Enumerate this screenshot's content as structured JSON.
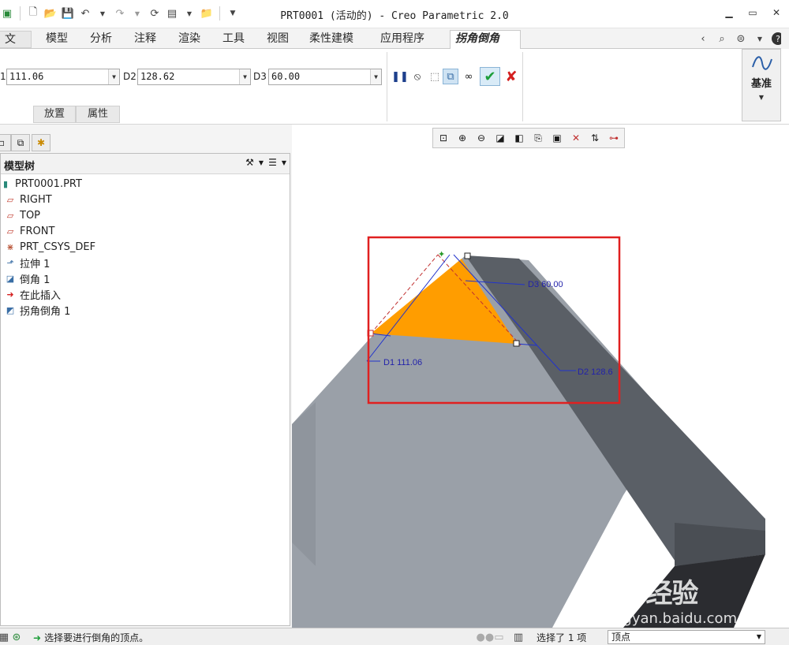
{
  "window": {
    "title": "PRT0001 (活动的) - Creo Parametric 2.0"
  },
  "tabs": [
    {
      "label": "文件",
      "left": 0
    },
    {
      "label": "模型"
    },
    {
      "label": "分析"
    },
    {
      "label": "注释"
    },
    {
      "label": "渲染"
    },
    {
      "label": "工具"
    },
    {
      "label": "视图"
    },
    {
      "label": "柔性建模"
    },
    {
      "label": "应用程序"
    },
    {
      "label": "拐角倒角"
    }
  ],
  "ribbon": {
    "d1_label": "1",
    "d1_value": "111.06",
    "d2_label": "D2",
    "d2_value": "128.62",
    "d3_label": "D3",
    "d3_value": "60.00",
    "subtab_placement": "放置",
    "subtab_properties": "属性",
    "datum_label": "基准"
  },
  "model_tree": {
    "title": "模型树",
    "items": [
      {
        "label": "PRT0001.PRT"
      },
      {
        "label": "RIGHT"
      },
      {
        "label": "TOP"
      },
      {
        "label": "FRONT"
      },
      {
        "label": "PRT_CSYS_DEF"
      },
      {
        "label": "拉伸 1"
      },
      {
        "label": "倒角 1"
      },
      {
        "label": "在此插入"
      },
      {
        "label": "拐角倒角 1"
      }
    ]
  },
  "graphics": {
    "dim_d1": "D1 111.06",
    "dim_d2": "D2 128.6",
    "dim_d3": "D3 60.00"
  },
  "watermark": {
    "logo": "Bai 经验",
    "url": "jingyan.baidu.com"
  },
  "status": {
    "message": "选择要进行倒角的顶点。",
    "selection": "选择了 1 项",
    "filter": "顶点"
  },
  "colors": {
    "chamfer_face": "#ff9d00",
    "highlight_box": "#e02020",
    "dimension": "#2222aa",
    "confirm": "#1e9e3a",
    "cancel": "#d42020"
  }
}
